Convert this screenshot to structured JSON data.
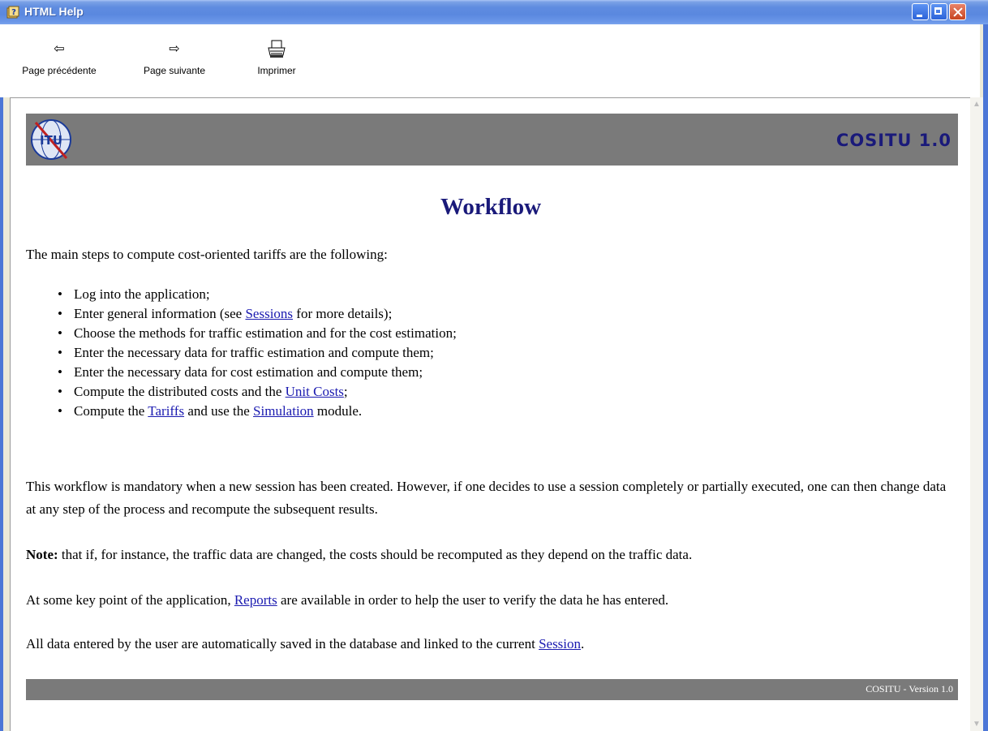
{
  "window": {
    "title": "HTML Help"
  },
  "toolbar": {
    "back_label": "Page précédente",
    "forward_label": "Page suivante",
    "print_label": "Imprimer"
  },
  "banner": {
    "product": "COSITU 1.0",
    "logo_text": "ITU"
  },
  "page": {
    "title": "Workflow",
    "intro": "The main steps to compute cost-oriented tariffs are the following:",
    "steps": {
      "s1": "Log into the application;",
      "s2_pre": "Enter general information (see ",
      "s2_link": "Sessions",
      "s2_post": " for more details);",
      "s3": "Choose the methods for traffic estimation and for the cost estimation;",
      "s4": "Enter the necessary data for traffic estimation and compute them;",
      "s5": "Enter the necessary data for cost estimation and compute them;",
      "s6_pre": "Compute the distributed costs and the ",
      "s6_link": "Unit Costs",
      "s6_post": ";",
      "s7_pre": "Compute the ",
      "s7_link1": "Tariffs",
      "s7_mid": " and use the ",
      "s7_link2": "Simulation",
      "s7_post": " module."
    },
    "mandatory": "This workflow is mandatory when a new session has been created. However, if one decides to use a session completely or partially executed, one can then change data at any step of the process and recompute the subsequent results.",
    "note_label": "Note:",
    "note_text": " that if, for instance, the traffic data are changed, the costs should be recomputed as they depend on the traffic data.",
    "reports_pre": "At some key point of the application, ",
    "reports_link": "Reports",
    "reports_post": " are available in order to help the user to verify the data he has entered.",
    "saved_pre": "All data entered by the user are automatically saved in the database and linked to the current ",
    "saved_link": "Session",
    "saved_post": ".",
    "footer": "COSITU - Version 1.0"
  },
  "icons": {
    "app": "help-book-icon",
    "back": "arrow-left-icon",
    "forward": "arrow-right-icon",
    "print": "printer-icon"
  },
  "colors": {
    "heading": "#1a1a7a",
    "link": "#1a1ab0",
    "banner": "#7a7a7a",
    "titlebar": "#5a88df"
  }
}
